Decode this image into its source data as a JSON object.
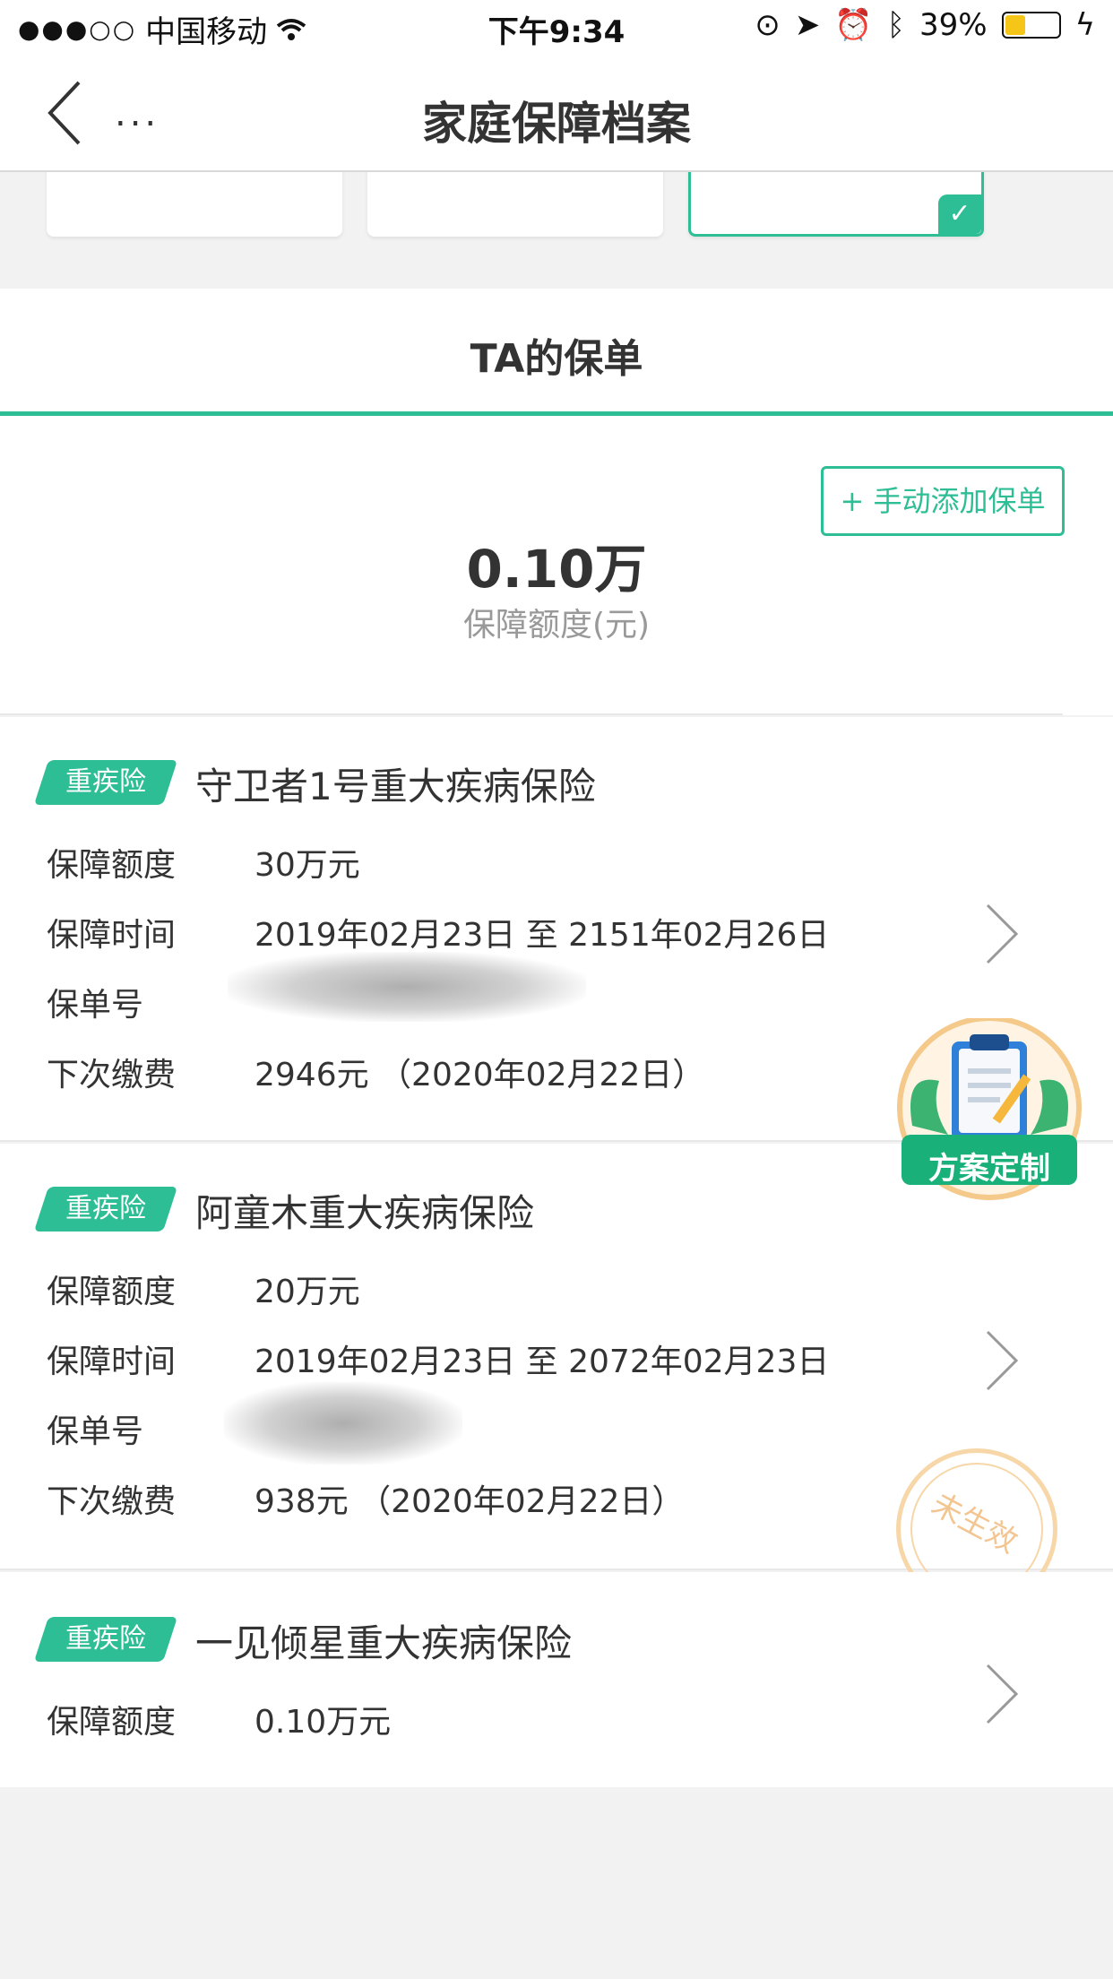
{
  "status_bar": {
    "carrier": "中国移动",
    "time": "下午9:34",
    "battery": "39%",
    "battery_level": 0.39
  },
  "nav": {
    "title": "家庭保障档案",
    "more": "..."
  },
  "tab": {
    "title": "TA的保单"
  },
  "summary": {
    "add_button": "+ 手动添加保单",
    "total_amount": "0.10万",
    "total_label": "保障额度(元)"
  },
  "policies": [
    {
      "tag": "重疾险",
      "name": "守卫者1号重大疾病保险",
      "rows": [
        {
          "label": "保障额度",
          "value": "30万元"
        },
        {
          "label": "保障时间",
          "value": "2019年02月23日  至  2151年02月26日"
        },
        {
          "label": "保单号",
          "value": ""
        },
        {
          "label": "下次缴费",
          "value": "2946元  （2020年02月22日）"
        }
      ]
    },
    {
      "tag": "重疾险",
      "name": "阿童木重大疾病保险",
      "rows": [
        {
          "label": "保障额度",
          "value": "20万元"
        },
        {
          "label": "保障时间",
          "value": "2019年02月23日  至  2072年02月23日"
        },
        {
          "label": "保单号",
          "value": ""
        },
        {
          "label": "下次缴费",
          "value": "938元  （2020年02月22日）"
        }
      ],
      "stamp": "未生效"
    },
    {
      "tag": "重疾险",
      "name": "一见倾星重大疾病保险",
      "rows": [
        {
          "label": "保障额度",
          "value": "0.10万元"
        }
      ]
    }
  ],
  "fab": {
    "label": "方案定制"
  },
  "colors": {
    "accent": "#2ebe95",
    "stamp": "#f3c590"
  }
}
